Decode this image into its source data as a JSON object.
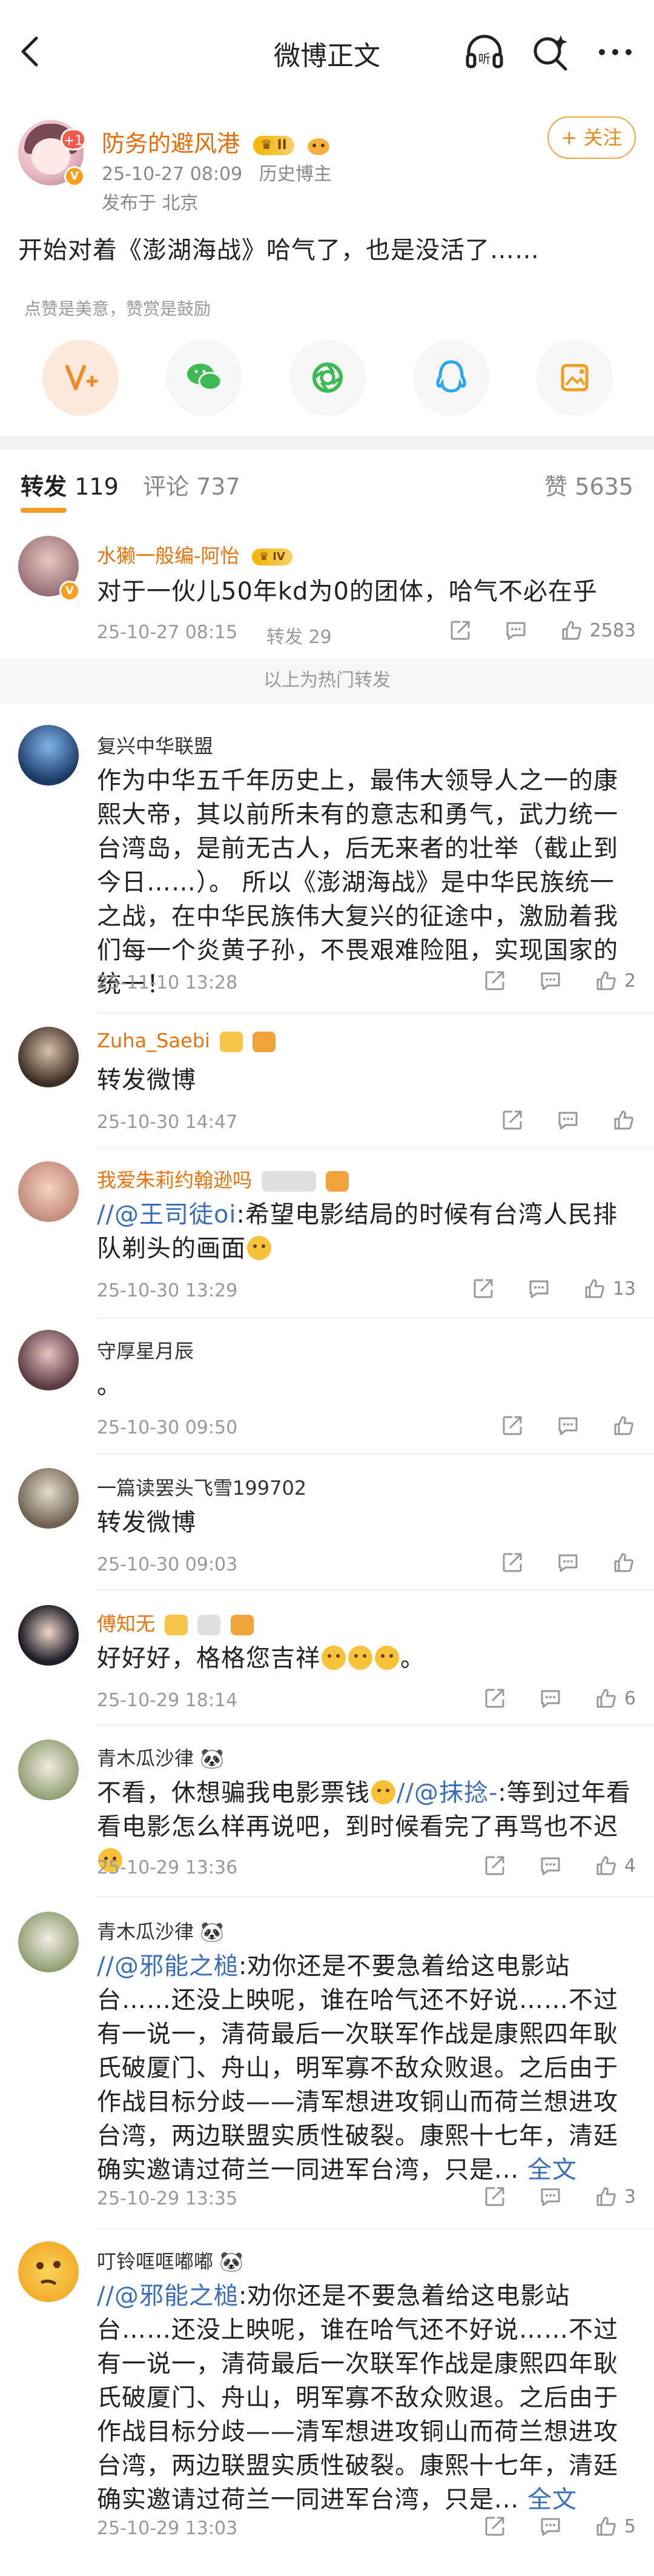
{
  "nav": {
    "title": "微博正文",
    "listen_label": "听"
  },
  "post": {
    "author": "防务的避风港",
    "level_badge": "II",
    "notify_count": "+1",
    "time": "25-10-27 08:09",
    "tag": "历史博主",
    "location": "发布于 北京",
    "follow_label": "+ 关注",
    "text": "开始对着《澎湖海战》哈气了，也是没活了……",
    "like_hint": "点赞是美意，赞赏是鼓励"
  },
  "share": {
    "items": [
      "vplus-icon",
      "wechat-icon",
      "moments-icon",
      "qq-icon",
      "save-icon"
    ]
  },
  "tabs": {
    "repost_label": "转发",
    "repost_count": "119",
    "comment_label": "评论",
    "comment_count": "737",
    "like_label": "赞",
    "like_count": "5635"
  },
  "hot_divider": "以上为热门转发",
  "reposts": [
    {
      "user": "水獭一般编-阿怡",
      "content": "对于一伙儿50年kd为0的团体，哈气不必在乎",
      "time": "25-10-27 08:15",
      "repost_label": "转发 29",
      "likes": "2583"
    },
    {
      "user": "复兴中华联盟",
      "content": "作为中华五千年历史上，最伟大领导人之一的康熙大帝，其以前所未有的意志和勇气，武力统一台湾岛，是前无古人，后无来者的壮举（截止到今日……）。  所以《澎湖海战》是中华民族统一之战，在中华民族伟大复兴的征途中，激励着我们每一个炎黄子孙，不畏艰难险阻，实现国家的统一！",
      "time": "25-11-10 13:28",
      "likes": "2"
    },
    {
      "user": "Zuha_Saebi",
      "content": "转发微博",
      "time": "25-10-30 14:47",
      "likes": ""
    },
    {
      "user": "我爱朱莉约翰逊吗",
      "mention": "//@王司徒oi",
      "content": ":希望电影结局的时候有台湾人民排队剃头的画面",
      "time": "25-10-30 13:29",
      "likes": "13"
    },
    {
      "user": "守厚星月辰",
      "content": "。",
      "time": "25-10-30 09:50",
      "likes": ""
    },
    {
      "user": "一篇读罢头飞雪199702",
      "content": "转发微博",
      "time": "25-10-30 09:03",
      "likes": ""
    },
    {
      "user": "傅知无",
      "content": "好好好，格格您吉祥",
      "time": "25-10-29 18:14",
      "likes": "6"
    },
    {
      "user": "青木瓜沙律",
      "content_a": "不看，休想骗我电影票钱",
      "mention": "//@抹捻-",
      "content_b": ":等到过年看看电影怎么样再说吧，到时候看完了再骂也不迟",
      "time": "25-10-29 13:36",
      "likes": "4"
    },
    {
      "user": "青木瓜沙律",
      "mention": "//@邪能之槌",
      "content": ":劝你还是不要急着给这电影站台……还没上映呢，谁在哈气还不好说……不过有一说一，清荷最后一次联军作战是康熙四年耿氏破厦门、舟山，明军寡不敌众败退。之后由于作战目标分歧——清军想进攻铜山而荷兰想进攻台湾，两边联盟实质性破裂。康熙十七年，清廷确实邀请过荷兰一同进军台湾，只是...",
      "more": "全文",
      "time": "25-10-29 13:35",
      "likes": "3"
    },
    {
      "user": "叮铃哐哐嘟嘟",
      "mention": "//@邪能之槌",
      "content": ":劝你还是不要急着给这电影站台……还没上映呢，谁在哈气还不好说……不过有一说一，清荷最后一次联军作战是康熙四年耿氏破厦门、舟山，明军寡不敌众败退。之后由于作战目标分歧——清军想进攻铜山而荷兰想进攻台湾，两边联盟实质性破裂。康熙十七年，清廷确实邀请过荷兰一同进军台湾，只是...",
      "more": "全文",
      "time": "25-10-29 13:03",
      "likes": "5"
    }
  ]
}
